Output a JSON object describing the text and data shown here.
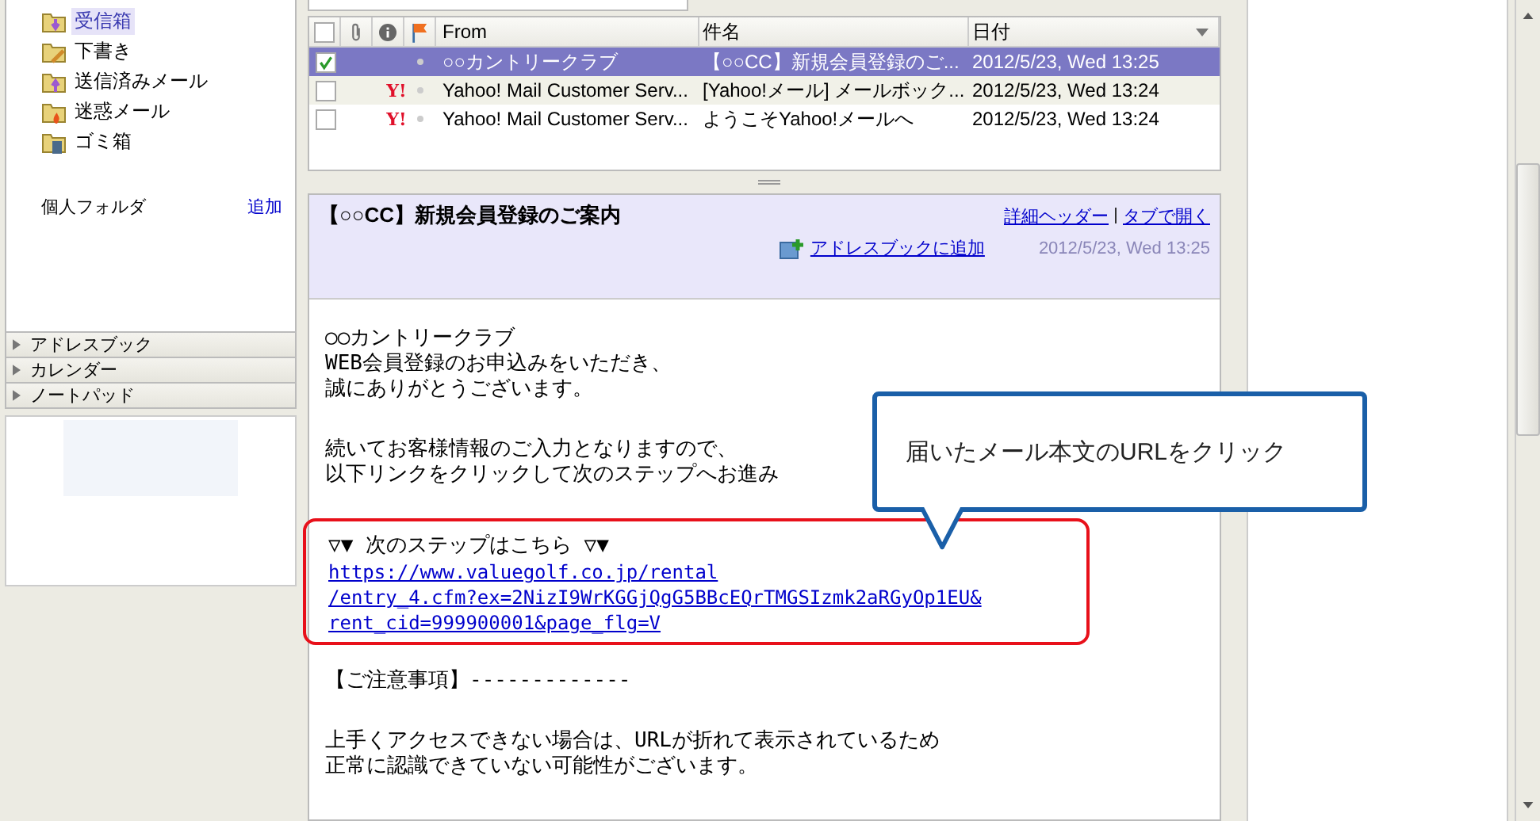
{
  "folders": [
    {
      "kind": "inbox",
      "name": "受信箱",
      "selected": true
    },
    {
      "kind": "drafts",
      "name": "下書き",
      "selected": false
    },
    {
      "kind": "sent",
      "name": "送信済みメール",
      "selected": false
    },
    {
      "kind": "spam",
      "name": "迷惑メール",
      "selected": false
    },
    {
      "kind": "trash",
      "name": "ゴミ箱",
      "selected": false
    }
  ],
  "personal_folders": {
    "label": "個人フォルダ",
    "add_link": "追加"
  },
  "sections": [
    "アドレスブック",
    "カレンダー",
    "ノートパッド"
  ],
  "message_list": {
    "select_all": false,
    "columns": {
      "from": "From",
      "subject": "件名",
      "date": "日付"
    },
    "rows": [
      {
        "checked": true,
        "selected": true,
        "logo": "",
        "from": "○○カントリークラブ",
        "subject": "【○○CC】新規会員登録のご...",
        "date": "2012/5/23, Wed 13:25"
      },
      {
        "checked": false,
        "selected": false,
        "logo": "Y!",
        "from": "Yahoo! Mail Customer Serv...",
        "subject": "[Yahoo!メール] メールボック...",
        "date": "2012/5/23, Wed 13:24"
      },
      {
        "checked": false,
        "selected": false,
        "logo": "Y!",
        "from": "Yahoo! Mail Customer Serv...",
        "subject": "ようこそYahoo!メールへ",
        "date": "2012/5/23, Wed 13:24"
      }
    ]
  },
  "message": {
    "title": "【○○CC】新規会員登録のご案内",
    "header_links": [
      "詳細ヘッダー",
      "タブで開く"
    ],
    "add_contact": "アドレスブックに追加",
    "date": "2012/5/23, Wed 13:25",
    "body": [
      {
        "kind": "text",
        "lines": [
          "○○カントリークラブ",
          "WEB会員登録のお申込みをいただき、",
          "誠にありがとうございます。"
        ]
      },
      {
        "kind": "text",
        "lines": [
          "続いてお客様情報のご入力となりますので、",
          "以下リンクをクリックして次のステップへお進み"
        ]
      },
      {
        "kind": "link",
        "highlighted": true,
        "heading": "▽▼ 次のステップはこちら ▽▼",
        "lines": [
          "https://www.valuegolf.co.jp/rental",
          "/entry_4.cfm?ex=2NizI9WrKGGjQgG5BBcEQrTMGSIzmk2aRGyOp1EU&",
          "rent_cid=999900001&page_flg=V"
        ]
      },
      {
        "kind": "text",
        "lines": [
          "【ご注意事項】-------------"
        ]
      },
      {
        "kind": "text",
        "lines": [
          "上手くアクセスできない場合は、URLが折れて表示されているため",
          "正常に認識できていない可能性がございます。"
        ]
      }
    ]
  },
  "callout": {
    "text": "届いたメール本文のURLをクリック"
  }
}
